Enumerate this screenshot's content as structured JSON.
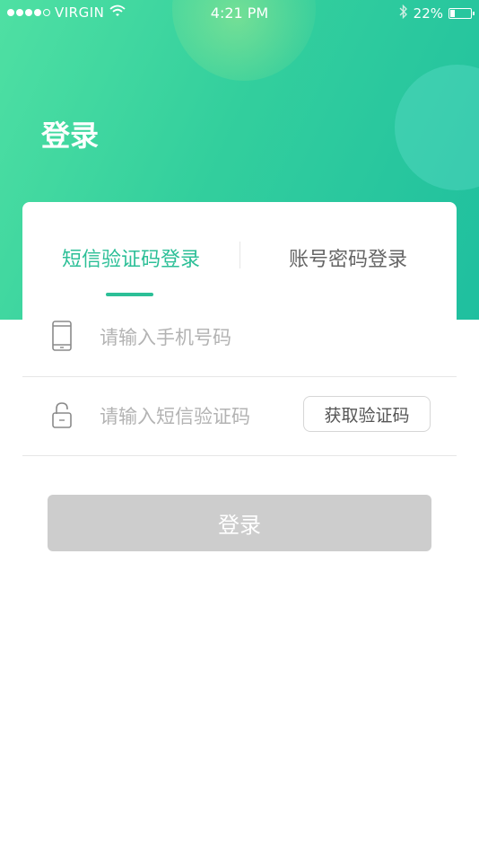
{
  "status_bar": {
    "carrier": "VIRGIN",
    "time": "4:21 PM",
    "battery": "22%",
    "battery_level": 0.22,
    "signal_dots_filled": 4,
    "signal_dots_total": 5,
    "icons": [
      "wifi-icon",
      "bluetooth-icon",
      "battery-icon"
    ]
  },
  "header": {
    "title": "登录"
  },
  "tabs": [
    {
      "label": "短信验证码登录",
      "active": true
    },
    {
      "label": "账号密码登录",
      "active": false
    }
  ],
  "form": {
    "phone": {
      "placeholder": "请输入手机号码",
      "value": "",
      "icon": "phone-icon"
    },
    "code": {
      "placeholder": "请输入短信验证码",
      "value": "",
      "icon": "lock-icon"
    },
    "get_code_label": "获取验证码"
  },
  "login_button": {
    "label": "登录",
    "enabled": false
  },
  "colors": {
    "accent": "#2cbf97",
    "gradient_start": "#4fe0a3",
    "gradient_end": "#1fbf9f",
    "disabled_button": "#cdcdcd"
  }
}
